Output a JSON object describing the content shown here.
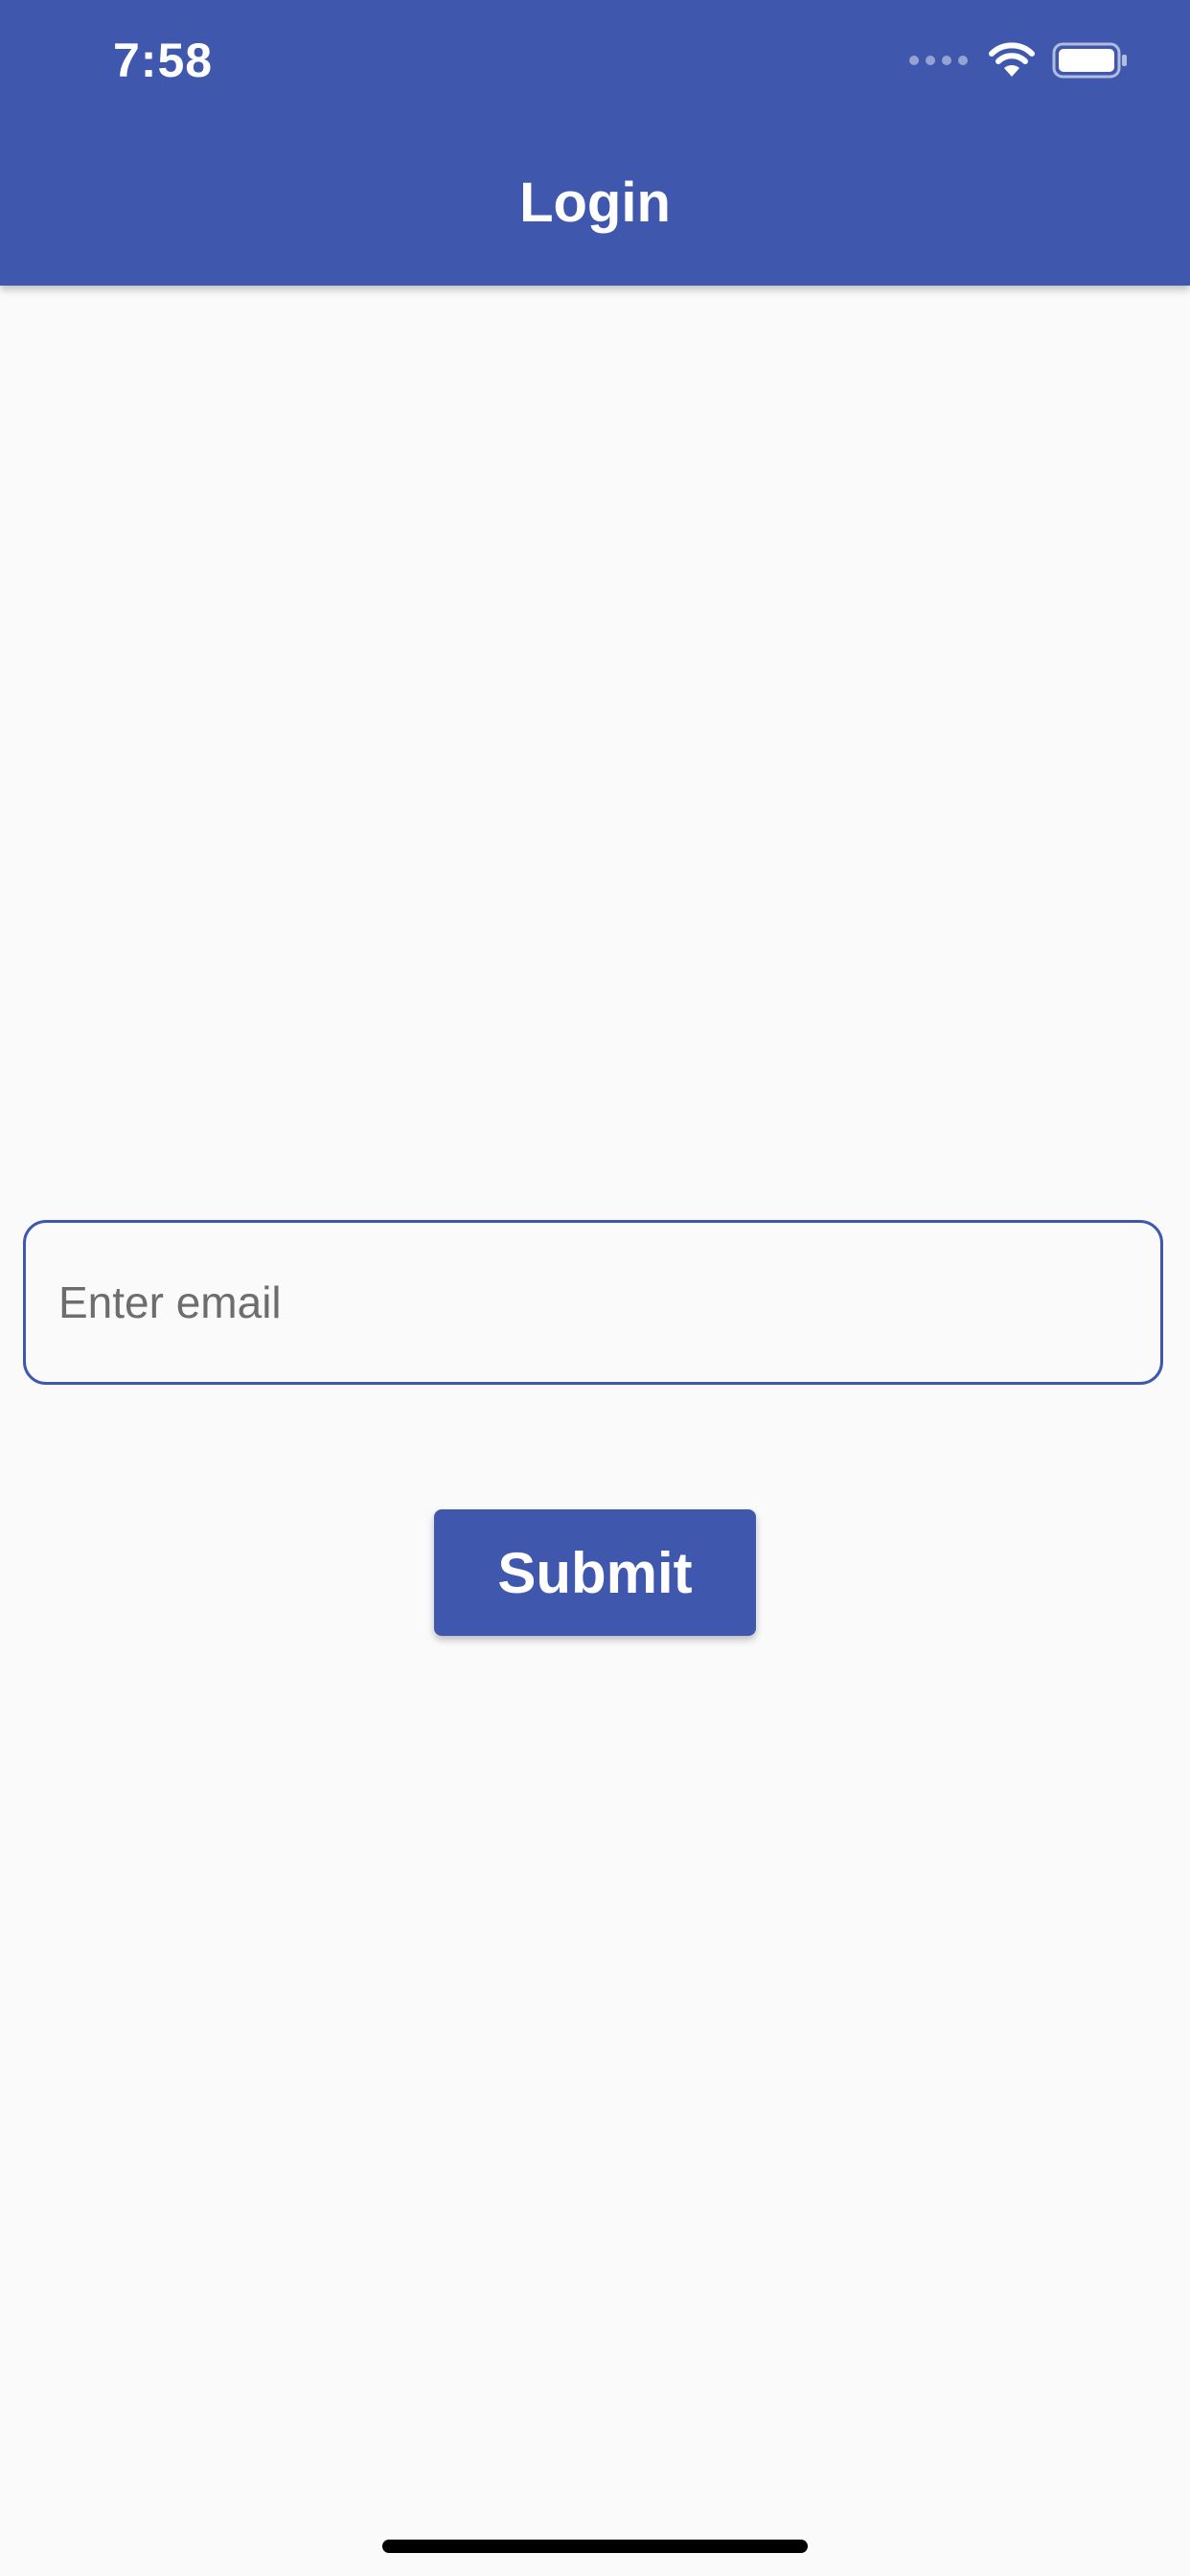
{
  "status_bar": {
    "time": "7:58",
    "icons": [
      "signal-dots-icon",
      "wifi-icon",
      "battery-icon"
    ]
  },
  "app_bar": {
    "title": "Login",
    "color": "#3f58ad"
  },
  "form": {
    "email_placeholder": "Enter email",
    "email_value": "",
    "submit_label": "Submit"
  },
  "colors": {
    "primary": "#3f58ad",
    "background": "#fafafa",
    "on_primary": "#ffffff"
  }
}
